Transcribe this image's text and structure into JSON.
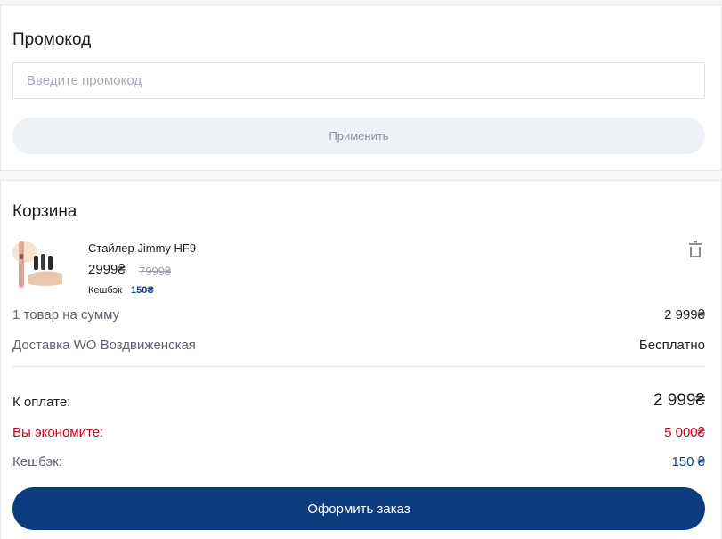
{
  "promo": {
    "title": "Промокод",
    "input_placeholder": "Введите промокод",
    "input_value": "",
    "apply_label": "Применить"
  },
  "cart": {
    "title": "Корзина",
    "items": [
      {
        "name": "Стайлер Jimmy HF9",
        "price": "2999₴",
        "old_price": "7999₴",
        "cashback_label": "Кешбэк",
        "cashback_value": "150₴",
        "delete_icon": "trash-icon"
      }
    ],
    "summary": {
      "items_label": "1 товар на сумму",
      "items_value": "2 999₴",
      "delivery_label": "Доставка WO Воздвиженская",
      "delivery_value": "Бесплатно",
      "total_label": "К оплате:",
      "total_value": "2 999₴",
      "savings_label": "Вы экономите:",
      "savings_value": "5 000₴",
      "cashback_label": "Кешбэк:",
      "cashback_value": "150 ₴"
    },
    "checkout_label": "Оформить заказ"
  },
  "colors": {
    "primary": "#0d3b80",
    "savings": "#d0021b",
    "cashback": "#173d7a",
    "disabled_button_bg": "#eef1f5"
  }
}
